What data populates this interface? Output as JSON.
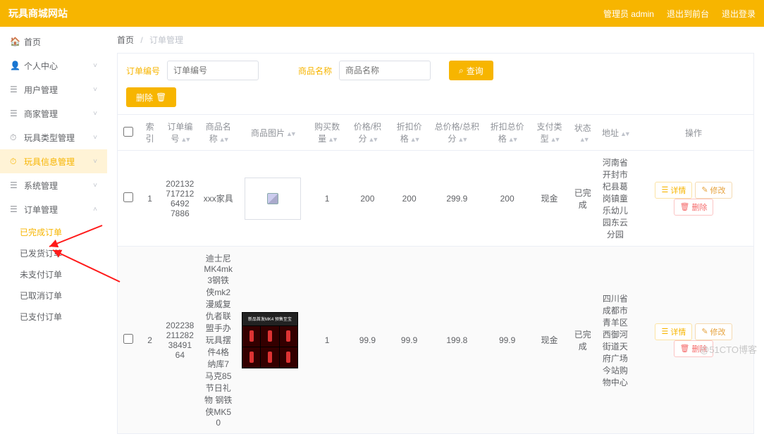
{
  "header": {
    "title": "玩具商城网站",
    "admin_label": "管理员 admin",
    "exit_front": "退出到前台",
    "exit_login": "退出登录"
  },
  "sidebar": {
    "items": [
      {
        "icon": "🏠",
        "label": "首页",
        "arrow": ""
      },
      {
        "icon": "👤",
        "label": "个人中心",
        "arrow": "˅"
      },
      {
        "icon": "☰",
        "label": "用户管理",
        "arrow": "˅"
      },
      {
        "icon": "☰",
        "label": "商家管理",
        "arrow": "˅"
      },
      {
        "icon": "⏱",
        "label": "玩具类型管理",
        "arrow": "˅"
      },
      {
        "icon": "⏱",
        "label": "玩具信息管理",
        "arrow": "˅"
      },
      {
        "icon": "☰",
        "label": "系统管理",
        "arrow": "˅"
      },
      {
        "icon": "☰",
        "label": "订单管理",
        "arrow": "˄"
      }
    ],
    "sub_items": [
      {
        "label": "已完成订单",
        "active": true
      },
      {
        "label": "已发货订单",
        "active": false
      },
      {
        "label": "未支付订单",
        "active": false
      },
      {
        "label": "已取消订单",
        "active": false
      },
      {
        "label": "已支付订单",
        "active": false
      }
    ]
  },
  "breadcrumb": {
    "home": "首页",
    "current": "订单管理"
  },
  "search": {
    "label_orderid": "订单编号",
    "ph_orderid": "订单编号",
    "label_name": "商品名称",
    "ph_name": "商品名称",
    "query_btn": "查询",
    "query_icon": "⌕"
  },
  "toolbar": {
    "delete_btn": "删除",
    "delete_icon": "🗑"
  },
  "columns": {
    "c0": "",
    "c1": "索引",
    "c2": "订单编号",
    "c3": "商品名称",
    "c4": "商品图片",
    "c5": "购买数量",
    "c6": "价格/积分",
    "c7": "折扣价格",
    "c8": "总价格/总积分",
    "c9": "折扣总价格",
    "c10": "支付类型",
    "c11": "状态",
    "c12": "地址",
    "c13": "操作"
  },
  "rows": [
    {
      "idx": "1",
      "orderid": "2021327172126492\n7886",
      "name": "xxx家具",
      "img_kind": "broken",
      "img_label": "",
      "qty": "1",
      "price": "200",
      "disc": "200",
      "total": "299.9",
      "disc_total": "200",
      "pay": "现金",
      "status": "已完成",
      "addr": "河南省开封市杞县葛岗镇童乐幼儿园东云分园"
    },
    {
      "idx": "2",
      "orderid": "20223821128238491\n64",
      "name": "迪士尼MK4mk3钢铁侠mk2漫威复仇者联盟手办玩具摆件4格纳库7马克85节日礼物 钢铁侠MK50",
      "img_kind": "grid",
      "img_label": "新品首发MK4 预售至宝",
      "qty": "1",
      "price": "99.9",
      "disc": "99.9",
      "total": "199.8",
      "disc_total": "99.9",
      "pay": "现金",
      "status": "已完成",
      "addr": "四川省成都市青羊区西御河街道天府广场今站购物中心"
    }
  ],
  "ops": {
    "detail": "详情",
    "edit": "修改",
    "del": "删除",
    "i_detail": "☰",
    "i_edit": "✎",
    "i_del": "🗑"
  },
  "watermark": "@51CTO博客"
}
